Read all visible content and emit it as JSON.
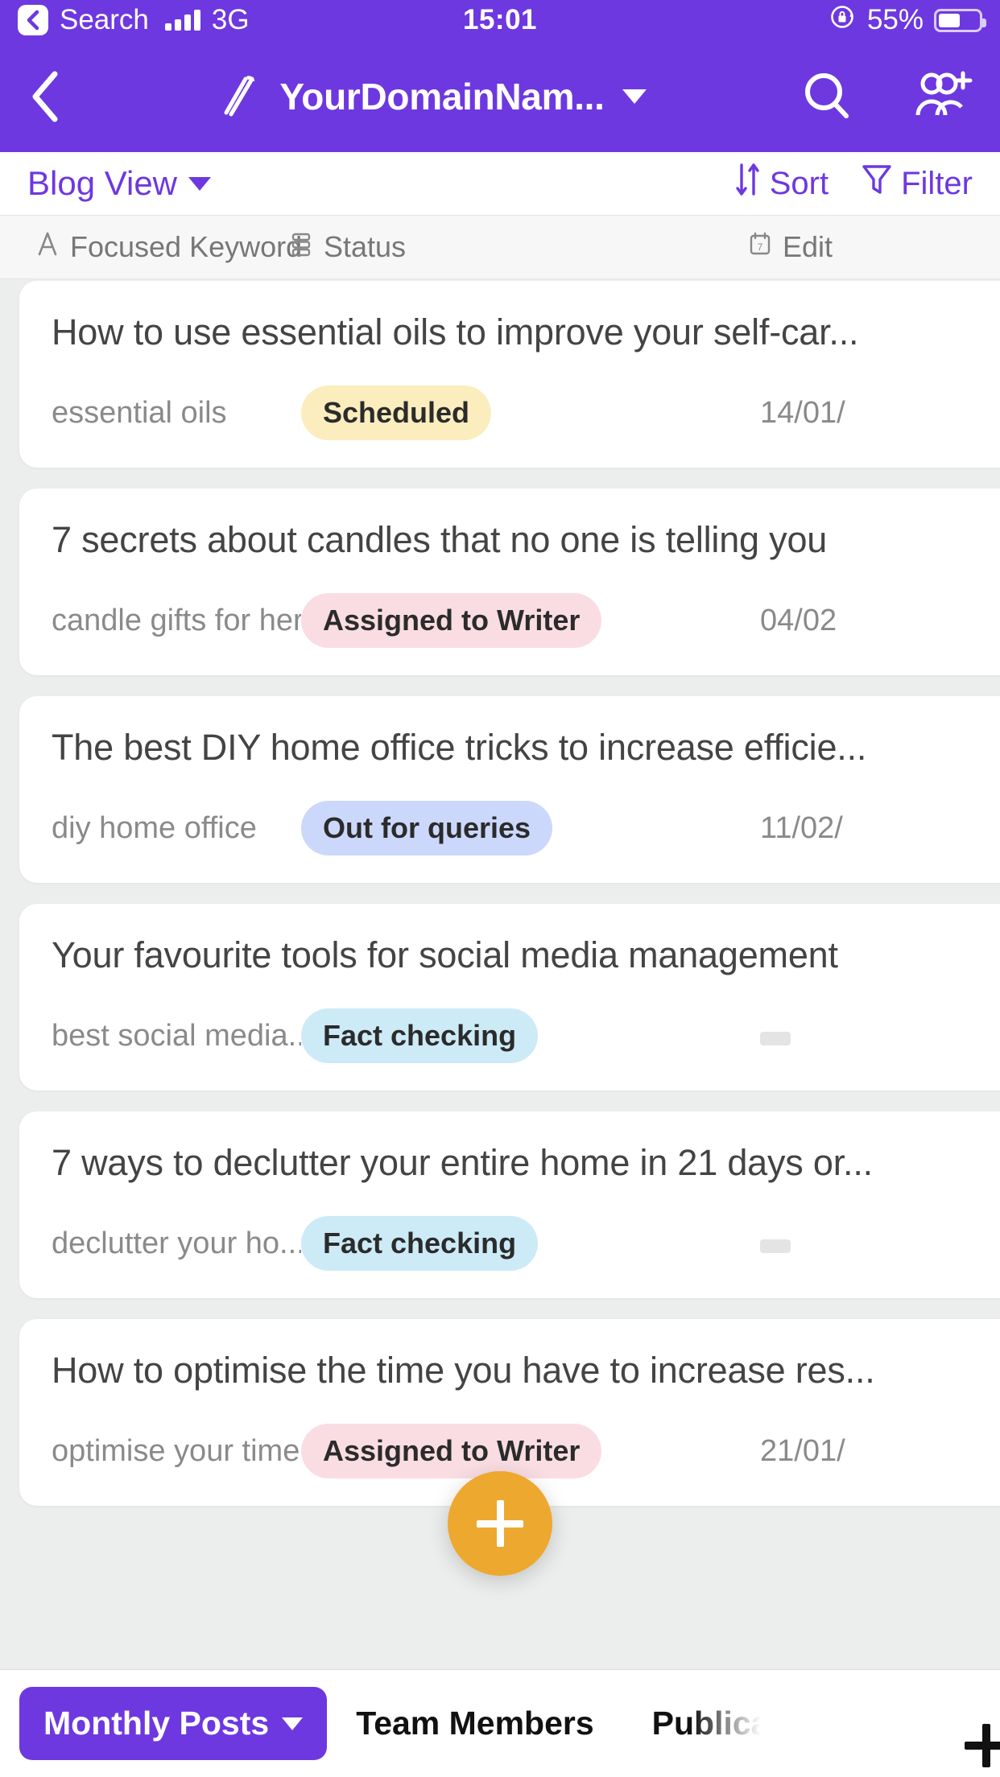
{
  "status_bar": {
    "back_label": "Search",
    "back_icon": "chevron-left-icon",
    "signal_icon": "cellular-bars-icon",
    "network": "3G",
    "time": "15:01",
    "rotation_lock_icon": "rotation-lock-icon",
    "battery_percent": "55%",
    "battery_icon": "battery-icon",
    "battery_level": 55
  },
  "nav_bar": {
    "back_icon": "chevron-left-icon",
    "edit_icon": "pencil-icon",
    "title": "YourDomainNam...",
    "dropdown_icon": "chevron-down-icon",
    "search_icon": "search-icon",
    "add_member_icon": "add-user-icon"
  },
  "view_toolbar": {
    "view_name": "Blog View",
    "view_dropdown_icon": "chevron-down-icon",
    "sort_label": "Sort",
    "sort_icon": "sort-icon",
    "filter_label": "Filter",
    "filter_icon": "filter-icon"
  },
  "columns": [
    {
      "label": "Focused Keyword",
      "icon": "text-field-icon"
    },
    {
      "label": "Status",
      "icon": "select-list-icon"
    },
    {
      "label": "Edit",
      "icon": "calendar-icon"
    }
  ],
  "records": [
    {
      "title": "How to use essential oils to improve your self-car...",
      "keyword": "essential oils",
      "status": "Scheduled",
      "status_bg": "#fbedbe",
      "date": "14/01/"
    },
    {
      "title": "7 secrets about candles that no one is telling you",
      "keyword": "candle gifts for her",
      "status": "Assigned to Writer",
      "status_bg": "#fadde3",
      "date": "04/02"
    },
    {
      "title": "The best DIY home office tricks to increase efficie...",
      "keyword": "diy home office",
      "status": "Out for queries",
      "status_bg": "#ccd8fb",
      "date": "11/02/"
    },
    {
      "title": "Your favourite tools for social media management",
      "keyword": "best social media...",
      "status": "Fact checking",
      "status_bg": "#cdeaf7",
      "date": ""
    },
    {
      "title": "7 ways to declutter your entire home in 21 days or...",
      "keyword": "declutter your ho...",
      "status": "Fact checking",
      "status_bg": "#cdeaf7",
      "date": ""
    },
    {
      "title": "How to optimise the time you have to increase res...",
      "keyword": "optimise your time",
      "status": "Assigned to Writer",
      "status_bg": "#fadde3",
      "date": "21/01/"
    }
  ],
  "fab": {
    "icon": "plus-icon"
  },
  "bottom_bar": {
    "tabs": [
      {
        "label": "Monthly Posts",
        "active": true,
        "dropdown_icon": "chevron-down-icon"
      },
      {
        "label": "Team Members",
        "active": false
      },
      {
        "label": "Publicat",
        "active": false
      }
    ],
    "add_tab_icon": "plus-icon"
  },
  "colors": {
    "brand_purple": "#6d38e0",
    "fab_orange": "#eda92f",
    "page_bg": "#eceded"
  }
}
